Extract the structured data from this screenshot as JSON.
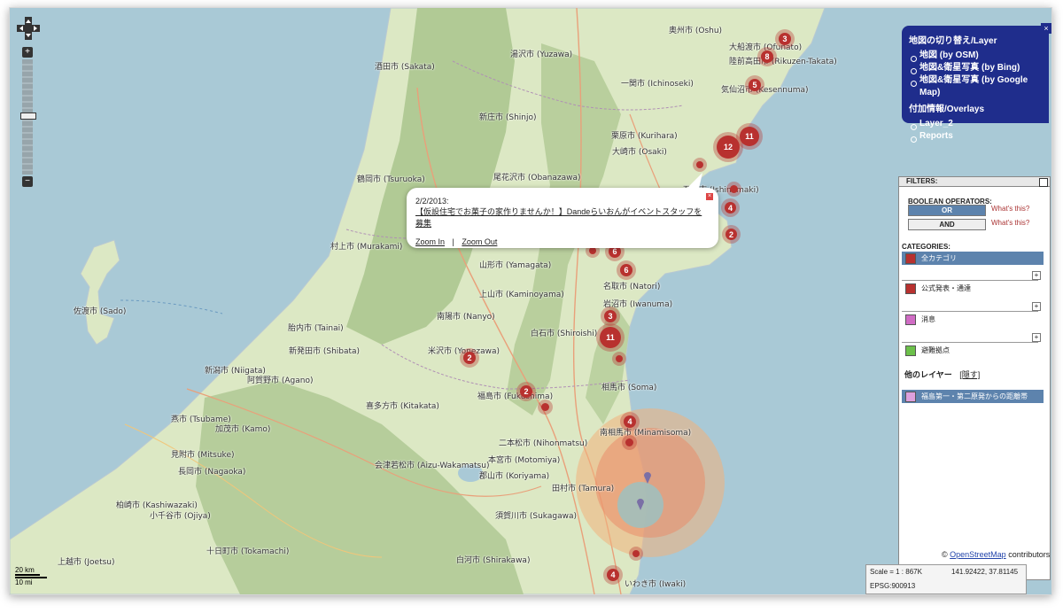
{
  "cities": [
    {
      "label": "奥州市 (Oshu)"
    },
    {
      "label": "大船渡市 (Ofunato)"
    },
    {
      "label": "陸前高田市 (Rikuzen-Takata)"
    },
    {
      "label": "湯沢市 (Yuzawa)"
    },
    {
      "label": "一関市 (Ichinoseki)"
    },
    {
      "label": "酒田市 (Sakata)"
    },
    {
      "label": "気仙沼市 (Kesennuma)"
    },
    {
      "label": "新庄市 (Shinjo)"
    },
    {
      "label": "栗原市 (Kurihara)"
    },
    {
      "label": "大崎市 (Osaki)"
    },
    {
      "label": "尾花沢市 (Obanazawa)"
    },
    {
      "label": "鶴岡市 (Tsuruoka)"
    },
    {
      "label": "石巻市 (Ishinomaki)"
    },
    {
      "label": "村上市 (Murakami)"
    },
    {
      "label": "山形市 (Yamagata)"
    },
    {
      "label": "上山市 (Kaminoyama)"
    },
    {
      "label": "名取市 (Natori)"
    },
    {
      "label": "岩沼市 (Iwanuma)"
    },
    {
      "label": "南陽市 (Nanyo)"
    },
    {
      "label": "佐渡市 (Sado)"
    },
    {
      "label": "胎内市 (Tainai)"
    },
    {
      "label": "白石市 (Shiroishi)"
    },
    {
      "label": "新発田市 (Shibata)"
    },
    {
      "label": "米沢市 (Yonezawa)"
    },
    {
      "label": "新潟市 (Niigata)"
    },
    {
      "label": "阿賀野市 (Agano)"
    },
    {
      "label": "相馬市 (Soma)"
    },
    {
      "label": "福島市 (Fukushima)"
    },
    {
      "label": "喜多方市 (Kitakata)"
    },
    {
      "label": "燕市 (Tsubame)"
    },
    {
      "label": "加茂市 (Kamo)"
    },
    {
      "label": "二本松市 (Nihonmatsu)"
    },
    {
      "label": "南相馬市 (Minamisoma)"
    },
    {
      "label": "見附市 (Mitsuke)"
    },
    {
      "label": "本宮市 (Motomiya)"
    },
    {
      "label": "長岡市 (Nagaoka)"
    },
    {
      "label": "会津若松市 (Aizu-Wakamatsu)"
    },
    {
      "label": "郡山市 (Koriyama)"
    },
    {
      "label": "田村市 (Tamura)"
    },
    {
      "label": "柏崎市 (Kashiwazaki)"
    },
    {
      "label": "須賀川市 (Sukagawa)"
    },
    {
      "label": "小千谷市 (Ojiya)"
    },
    {
      "label": "十日町市 (Tokamachi)"
    },
    {
      "label": "白河市 (Shirakawa)"
    },
    {
      "label": "上越市 (Joetsu)"
    },
    {
      "label": "いわき市 (Iwaki)"
    }
  ],
  "markers": [
    {
      "count": "3"
    },
    {
      "count": "8"
    },
    {
      "count": "5"
    },
    {
      "count": "11"
    },
    {
      "count": "12"
    },
    {
      "count": ""
    },
    {
      "count": ""
    },
    {
      "count": "4"
    },
    {
      "count": "2"
    },
    {
      "count": ""
    },
    {
      "count": "6"
    },
    {
      "count": "6"
    },
    {
      "count": "3"
    },
    {
      "count": "11"
    },
    {
      "count": ""
    },
    {
      "count": "2"
    },
    {
      "count": "2"
    },
    {
      "count": ""
    },
    {
      "count": "4"
    },
    {
      "count": ""
    },
    {
      "count": ""
    },
    {
      "count": "4"
    }
  ],
  "layer_switcher": {
    "base_header": "地図の切り替え/Layer",
    "base_items": [
      "地図 (by OSM)",
      "地図&衛星写真 (by Bing)",
      "地図&衛星写真 (by Google Map)"
    ],
    "overlay_header": "付加情報/Overlays",
    "overlay_items": [
      "Layer_2",
      "Reports"
    ],
    "close": "×"
  },
  "filters": {
    "header": "FILTERS:",
    "boolean_label": "BOOLEAN OPERATORS:",
    "or_label": "OR",
    "and_label": "AND",
    "whats_this": "What's this?",
    "categories_label": "CATEGORIES:",
    "categories": [
      {
        "label": "全カテゴリ",
        "color": "#b8312f"
      },
      {
        "label": "公式発表・通達",
        "color": "#b8312f"
      },
      {
        "label": "消息",
        "color": "#d06cc4"
      },
      {
        "label": "避難拠点",
        "color": "#6cc04a"
      }
    ],
    "other_layers_label": "他のレイヤー",
    "hide_label": "[隠す]",
    "other_layer_item": "福島第一・第二原発からの距離帯",
    "other_layer_color": "#dda0dd",
    "plus": "+"
  },
  "popup": {
    "date": "2/2/2013:",
    "event": "【仮設住宅でお菓子の家作りませんか！】Dandeらいおんがイベントスタッフを募集",
    "zoom_in": "Zoom In",
    "separator": "|",
    "zoom_out": "Zoom Out",
    "close": "×"
  },
  "zoom": {
    "plus": "+",
    "minus": "−"
  },
  "scale": {
    "km": "20 km",
    "mi": "10 mi"
  },
  "attribution": {
    "prefix": "©",
    "osm": "OpenStreetMap",
    "suffix": "contributors"
  },
  "status": {
    "scale": "Scale = 1 : 867K",
    "coords": "141.92422, 37.81145",
    "epsg": "EPSG:900913"
  },
  "colors": {
    "marker": "#b8312f",
    "layer_panel": "#1f2d8c",
    "sea": "#a9c9d6",
    "land": "#dce8c4",
    "mountain": "#a9c48d"
  }
}
